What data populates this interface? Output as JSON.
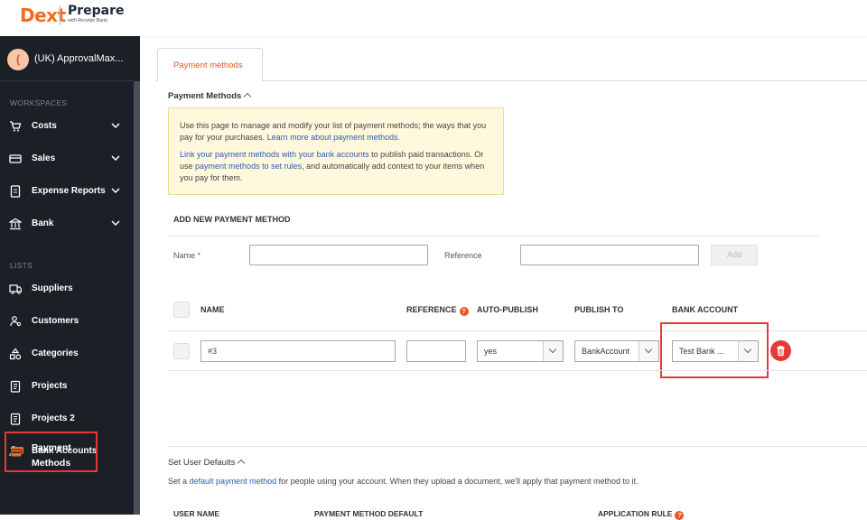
{
  "brand": {
    "logo_text": "Dext",
    "product": "Prepare",
    "product_sub": "with Receipt Bank",
    "accent_color": "#f26b21"
  },
  "sidebar": {
    "account_name": "(UK) ApprovalMax...",
    "account_initial": "(",
    "sections": {
      "workspaces": "WORKSPACES",
      "lists": "LISTS"
    },
    "workspace_items": [
      {
        "label": "Costs",
        "icon": "cart-icon"
      },
      {
        "label": "Sales",
        "icon": "sales-icon"
      },
      {
        "label": "Expense Reports",
        "icon": "expense-icon"
      },
      {
        "label": "Bank",
        "icon": "bank-icon"
      }
    ],
    "list_items": [
      {
        "label": "Suppliers",
        "icon": "truck-icon"
      },
      {
        "label": "Customers",
        "icon": "customers-icon"
      },
      {
        "label": "Categories",
        "icon": "categories-icon"
      },
      {
        "label": "Projects",
        "icon": "project-icon"
      },
      {
        "label": "Projects 2",
        "icon": "project-icon"
      },
      {
        "label": "Bank Accounts",
        "icon": "bank-accounts-icon"
      }
    ],
    "active_item": {
      "line1": "Payment",
      "line2": "Methods",
      "icon": "payment-methods-icon"
    }
  },
  "main": {
    "tab_label": "Payment methods",
    "section_title": "Payment Methods",
    "info": {
      "p1_text": "Use this page to manage and modify your list of payment methods; the ways that you pay for your purchases.",
      "p1_link": "Learn more about payment methods.",
      "p2_link1": "Link your payment methods with your bank accounts",
      "p2_text1": "to publish paid transactions. Or use",
      "p2_link2": "payment methods to set rules",
      "p2_text2": ", and automatically add context to your items when you pay for them."
    },
    "add_form": {
      "title": "ADD NEW PAYMENT METHOD",
      "name_label": "Name",
      "required_mark": "*",
      "reference_label": "Reference",
      "name_value": "",
      "reference_value": "",
      "add_button": "Add"
    },
    "table": {
      "headers": {
        "name": "NAME",
        "reference": "REFERENCE",
        "reference_help": "?",
        "auto_publish": "AUTO-PUBLISH",
        "publish_to": "PUBLISH TO",
        "bank_account": "BANK ACCOUNT"
      },
      "rows": [
        {
          "name": "#3",
          "reference": "",
          "auto_publish": "yes",
          "publish_to": "BankAccount",
          "bank_account": "Test Bank ..."
        }
      ]
    },
    "user_defaults": {
      "title": "Set User Defaults",
      "text_before": "Set a",
      "link": "default payment method",
      "text_after": "for people using your account. When they upload a document, we'll apply that payment method to it.",
      "headers": {
        "user_name": "USER NAME",
        "payment_method_default": "PAYMENT METHOD DEFAULT",
        "application_rule": "APPLICATION RULE"
      }
    }
  }
}
